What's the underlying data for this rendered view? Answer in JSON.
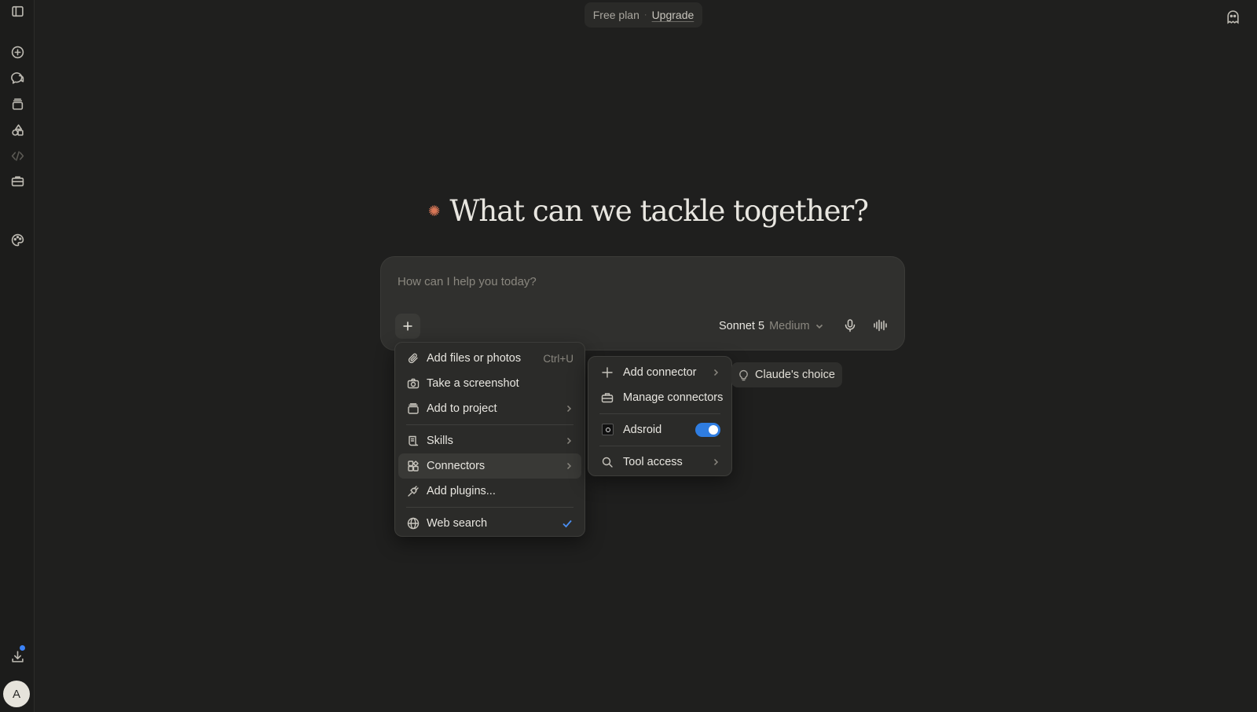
{
  "topbar": {
    "plan": "Free plan",
    "separator": "·",
    "upgrade": "Upgrade"
  },
  "hero": {
    "title": "What can we tackle together?"
  },
  "composer": {
    "placeholder": "How can I help you today?",
    "model_name": "Sonnet 5",
    "effort": "Medium"
  },
  "menu": {
    "items": [
      {
        "label": "Add files or photos",
        "shortcut": "Ctrl+U",
        "icon": "paperclip-icon"
      },
      {
        "label": "Take a screenshot",
        "icon": "camera-icon"
      },
      {
        "label": "Add to project",
        "icon": "project-box-icon"
      },
      {
        "label": "Skills",
        "icon": "skills-icon"
      },
      {
        "label": "Connectors",
        "icon": "connectors-icon"
      },
      {
        "label": "Add plugins...",
        "icon": "plug-icon"
      },
      {
        "label": "Web search",
        "icon": "globe-icon",
        "checked": true
      }
    ]
  },
  "submenu": {
    "items": [
      {
        "label": "Add connector",
        "icon": "plus-icon"
      },
      {
        "label": "Manage connectors",
        "icon": "toolbox-icon"
      },
      {
        "label": "Adsroid",
        "icon": "adsroid-logo-icon",
        "enabled": true
      },
      {
        "label": "Tool access",
        "icon": "search-icon"
      }
    ]
  },
  "chip": {
    "label": "Claude's choice"
  },
  "sidebar": {
    "avatar_initial": "A"
  },
  "colors": {
    "accent": "#d97757",
    "toggle_on": "#2f7de1",
    "check": "#4a8ef0",
    "background": "#1f1f1e"
  }
}
